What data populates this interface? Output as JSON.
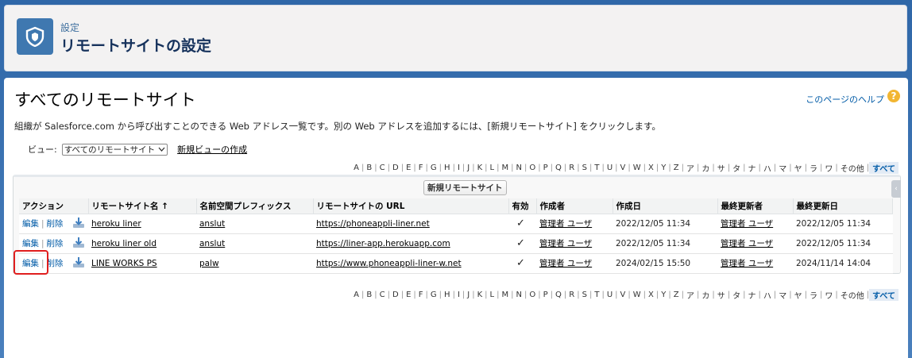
{
  "header": {
    "eyebrow": "設定",
    "title": "リモートサイトの設定"
  },
  "page": {
    "heading": "すべてのリモートサイト",
    "help_link": "このページのヘルプ",
    "help_icon": "?",
    "description": "組織が Salesforce.com から呼び出すことのできる Web アドレス一覧です。別の Web アドレスを追加するには、[新規リモートサイト] をクリックします。"
  },
  "view": {
    "label": "ビュー:",
    "selected": "すべてのリモートサイト",
    "create_link": "新規ビューの作成"
  },
  "alphabet": [
    "A",
    "B",
    "C",
    "D",
    "E",
    "F",
    "G",
    "H",
    "I",
    "J",
    "K",
    "L",
    "M",
    "N",
    "O",
    "P",
    "Q",
    "R",
    "S",
    "T",
    "U",
    "V",
    "W",
    "X",
    "Y",
    "Z",
    "ア",
    "カ",
    "サ",
    "タ",
    "ナ",
    "ハ",
    "マ",
    "ヤ",
    "ラ",
    "ワ",
    "その他"
  ],
  "alphabet_all": "すべて",
  "list": {
    "new_button": "新規リモートサイト",
    "columns": {
      "action": "アクション",
      "name": "リモートサイト名 ↑",
      "prefix": "名前空間プレフィックス",
      "url": "リモートサイトの URL",
      "active": "有効",
      "creator": "作成者",
      "created": "作成日",
      "modifier": "最終更新者",
      "modified": "最終更新日"
    },
    "edit_label": "編集",
    "delete_label": "削除",
    "rows": [
      {
        "name": "heroku liner",
        "prefix": "anslut",
        "url": "https://phoneappli-liner.net",
        "active": "✓",
        "creator": "管理者 ユーザ",
        "created": "2022/12/05 11:34",
        "modifier": "管理者 ユーザ",
        "modified": "2022/12/05 11:34"
      },
      {
        "name": "heroku liner old",
        "prefix": "anslut",
        "url": "https://liner-app.herokuapp.com",
        "active": "✓",
        "creator": "管理者 ユーザ",
        "created": "2022/12/05 11:34",
        "modifier": "管理者 ユーザ",
        "modified": "2022/12/05 11:34"
      },
      {
        "name": "LINE WORKS PS",
        "prefix": "palw",
        "url": "https://www.phoneappli-liner-w.net",
        "active": "✓",
        "creator": "管理者 ユーザ",
        "created": "2024/02/15 15:50",
        "modifier": "管理者 ユーザ",
        "modified": "2024/11/14 14:04"
      }
    ]
  },
  "colors": {
    "accent": "#015ba7",
    "badge": "#3f78b0",
    "highlight": "#e01e1e"
  }
}
